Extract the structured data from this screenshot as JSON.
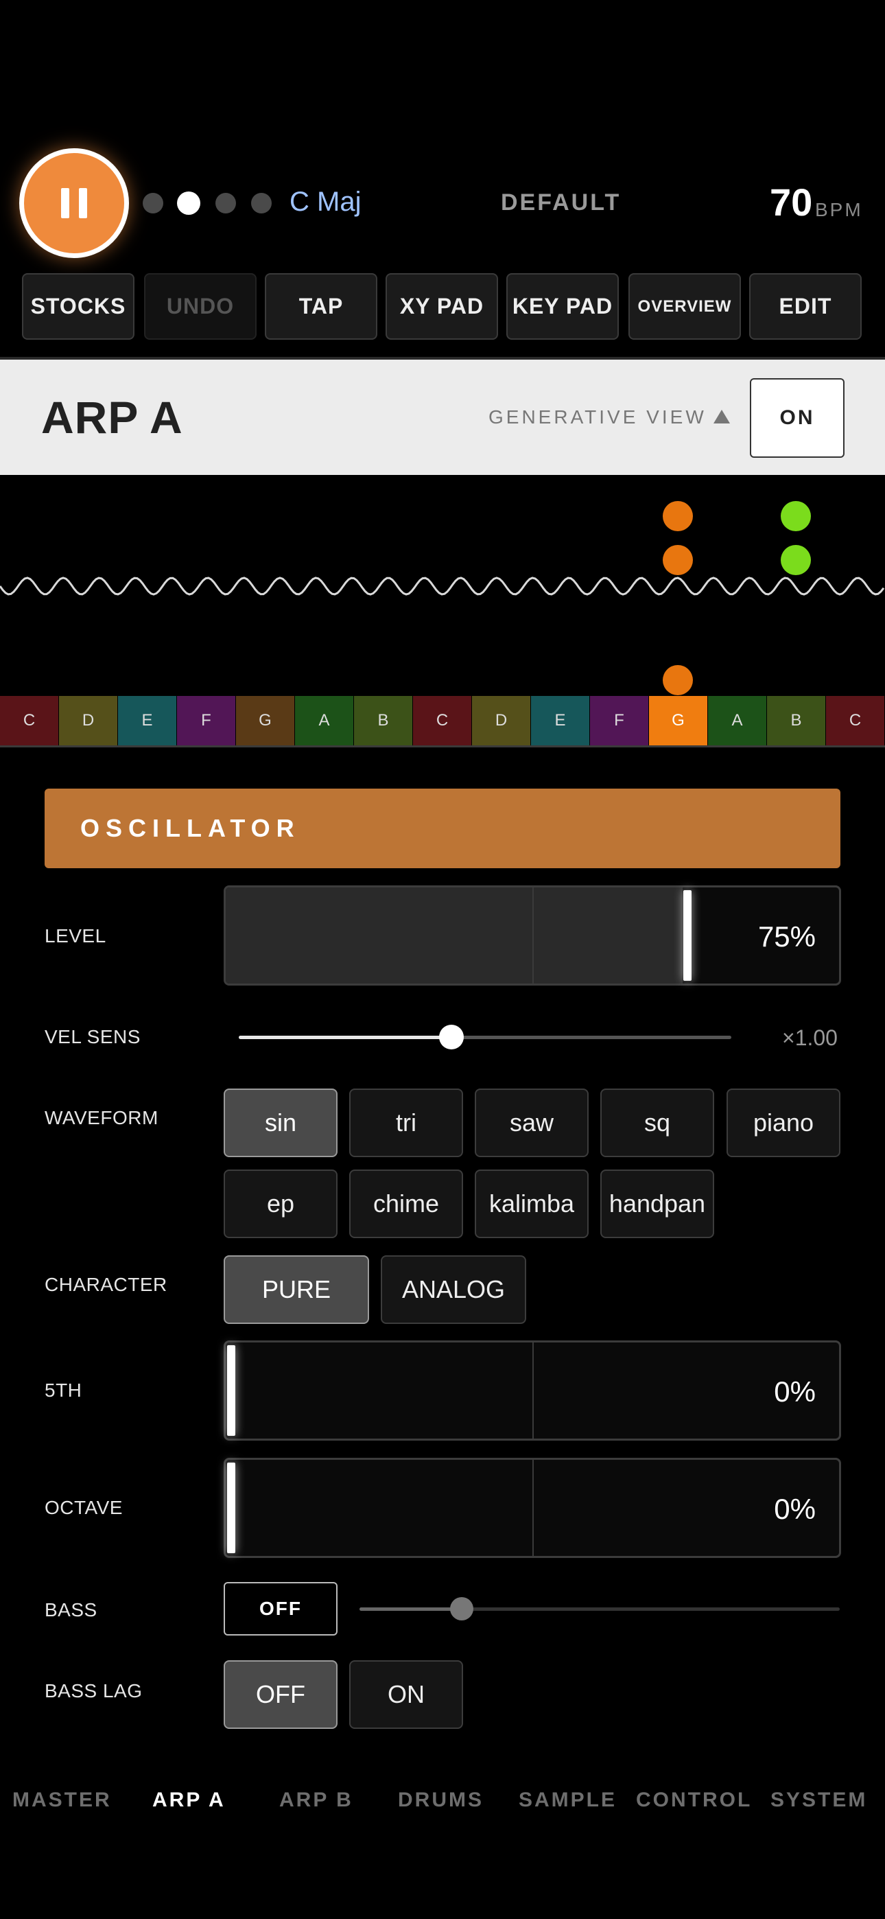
{
  "transport": {
    "state": "playing",
    "key": "C Maj",
    "preset": "DEFAULT",
    "bpm": "70",
    "bpm_unit": "BPM",
    "page_dots": 4,
    "active_page_dot": 2
  },
  "toolbar": [
    "STOCKS",
    "UNDO",
    "TAP",
    "XY PAD",
    "KEY PAD",
    "OVERVIEW",
    "EDIT"
  ],
  "header": {
    "title": "ARP A",
    "generative_view_label": "GENERATIVE VIEW",
    "on_label": "ON"
  },
  "keyboard": {
    "keys": [
      "C",
      "D",
      "E",
      "F",
      "G",
      "A",
      "B",
      "C",
      "D",
      "E",
      "F",
      "G",
      "A",
      "B",
      "C"
    ],
    "active_index": 11
  },
  "colors": {
    "accent": "#ef8a3c",
    "section": "#bd7535",
    "note_orange": "#e8760f",
    "note_green": "#7bdc1c"
  },
  "oscillator": {
    "title": "OSCILLATOR",
    "level": {
      "label": "LEVEL",
      "value": "75%",
      "fraction": 0.75
    },
    "vel_sens": {
      "label": "VEL SENS",
      "value": "×1.00",
      "fraction": 0.43
    },
    "waveform": {
      "label": "WAVEFORM",
      "options": [
        "sin",
        "tri",
        "saw",
        "sq",
        "piano",
        "ep",
        "chime",
        "kalimba",
        "handpan"
      ],
      "selected": "sin"
    },
    "character": {
      "label": "CHARACTER",
      "options": [
        "PURE",
        "ANALOG"
      ],
      "selected": "PURE"
    },
    "fifth": {
      "label": "5TH",
      "value": "0%",
      "fraction": 0
    },
    "octave": {
      "label": "OCTAVE",
      "value": "0%",
      "fraction": 0
    },
    "bass": {
      "label": "BASS",
      "toggle": "OFF",
      "fraction": 0.2
    },
    "bass_lag": {
      "label": "BASS LAG",
      "options": [
        "OFF",
        "ON"
      ],
      "selected": "OFF"
    }
  },
  "nav": {
    "items": [
      "MASTER",
      "ARP A",
      "ARP B",
      "DRUMS",
      "SAMPLE",
      "CONTROL",
      "SYSTEM"
    ],
    "active": "ARP A"
  }
}
